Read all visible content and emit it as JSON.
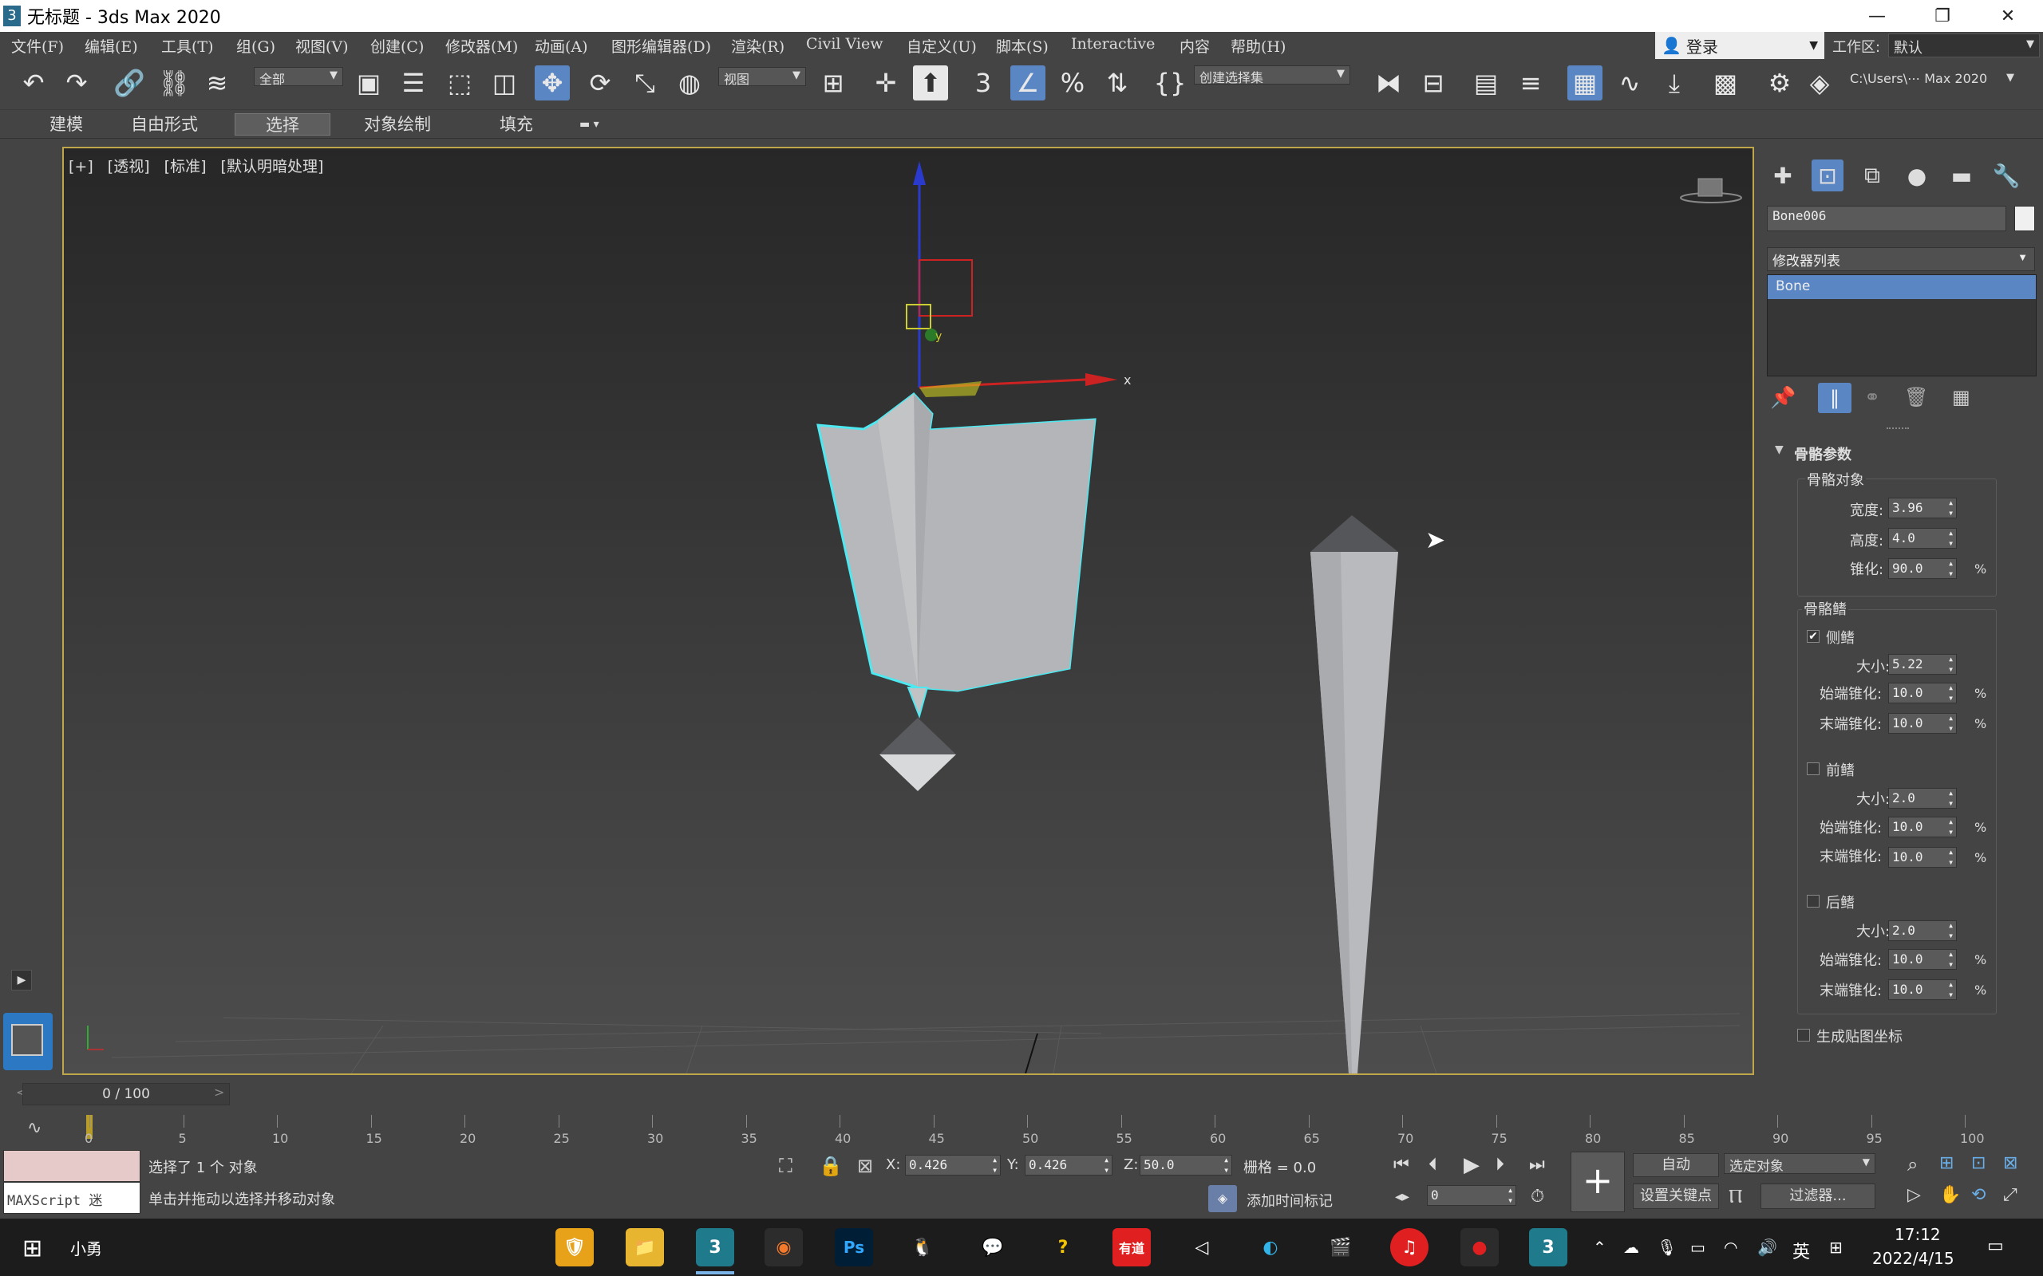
{
  "title": "无标题 - 3ds Max 2020",
  "window": {
    "minimize": "—",
    "restore": "❐",
    "close": "✕"
  },
  "menu": [
    "文件(F)",
    "编辑(E)",
    "工具(T)",
    "组(G)",
    "视图(V)",
    "创建(C)",
    "修改器(M)",
    "动画(A)",
    "图形编辑器(D)",
    "渲染(R)",
    "Civil View",
    "自定义(U)",
    "脚本(S)",
    "Interactive",
    "内容",
    "帮助(H)"
  ],
  "login": "登录",
  "workspace": {
    "label": "工作区:",
    "value": "默认"
  },
  "toolbar": {
    "filter_value": "全部",
    "refcoord_value": "视图",
    "selection_set_value": "创建选择集",
    "path_value": "C:\\Users\\⋯ Max 2020"
  },
  "ribbon": {
    "tabs": [
      "建模",
      "自由形式",
      "选择",
      "对象绘制",
      "填充"
    ],
    "selected": "选择"
  },
  "viewport": {
    "labels": [
      "[+]",
      "[透视]",
      "[标准]",
      "[默认明暗处理]"
    ],
    "axis_x": "x",
    "axis_y": "y"
  },
  "panel": {
    "object_name": "Bone006",
    "modifier_list": "修改器列表",
    "stack_item": "Bone",
    "rollout_title": "骨骼参数",
    "bone_object": {
      "group": "骨骼对象",
      "width_label": "宽度:",
      "width": "3.96",
      "height_label": "高度:",
      "height": "4.0",
      "taper_label": "锥化:",
      "taper": "90.0"
    },
    "fins": {
      "group": "骨骼鳍",
      "side": {
        "label": "侧鳍",
        "checked": "✔",
        "size_label": "大小:",
        "size": "5.22",
        "start_label": "始端锥化:",
        "start": "10.0",
        "end_label": "末端锥化:",
        "end": "10.0"
      },
      "front": {
        "label": "前鳍",
        "size_label": "大小:",
        "size": "2.0",
        "start_label": "始端锥化:",
        "start": "10.0",
        "end_label": "末端锥化:",
        "end": "10.0"
      },
      "back": {
        "label": "后鳍",
        "size_label": "大小:",
        "size": "2.0",
        "start_label": "始端锥化:",
        "start": "10.0",
        "end_label": "末端锥化:",
        "end": "10.0"
      }
    },
    "gen_map": "生成贴图坐标",
    "percent": "%"
  },
  "timeline": {
    "slider": "0 / 100",
    "ticks": [
      "0",
      "5",
      "10",
      "15",
      "20",
      "25",
      "30",
      "35",
      "40",
      "45",
      "50",
      "55",
      "60",
      "65",
      "70",
      "75",
      "80",
      "85",
      "90",
      "95",
      "100"
    ]
  },
  "status": {
    "maxscript": "MAXScript 迷",
    "selected": "选择了 1 个 对象",
    "hint": "单击并拖动以选择并移动对象",
    "x_label": "X:",
    "x": "0.426",
    "y_label": "Y:",
    "y": "0.426",
    "z_label": "Z:",
    "z": "50.0",
    "grid": "栅格 = 0.0",
    "add_time_tag": "添加时间标记",
    "auto": "自动",
    "selected_object": "选定对象",
    "set_key": "设置关键点",
    "filters": "过滤器...",
    "frame": "0"
  },
  "taskbar": {
    "user": "小勇",
    "ime": "英",
    "time": "17:12",
    "date": "2022/4/15",
    "youdao": "有道",
    "ps": "Ps"
  },
  "colors": {
    "viewport_border": "#bfa64a",
    "selection": "#4de8f0",
    "accent": "#5a86c4"
  }
}
